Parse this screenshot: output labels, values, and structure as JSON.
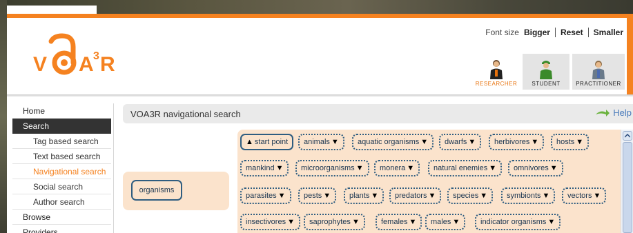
{
  "header": {
    "logo_text": "VOA3R",
    "font_size": {
      "label": "Font size",
      "bigger": "Bigger",
      "reset": "Reset",
      "smaller": "Smaller"
    },
    "roles": [
      {
        "label": "RESEARCHER",
        "icon": "researcher-icon"
      },
      {
        "label": "STUDENT",
        "icon": "student-icon"
      },
      {
        "label": "PRACTITIONER",
        "icon": "practitioner-icon"
      }
    ],
    "colors": {
      "accent": "#f58220",
      "node_border": "#2f5d80",
      "panel_bg": "#fbe3cc"
    }
  },
  "sidebar": {
    "items": [
      {
        "label": "Home"
      },
      {
        "label": "Search"
      },
      {
        "label": "Tag based search"
      },
      {
        "label": "Text based search"
      },
      {
        "label": "Navigational search"
      },
      {
        "label": "Social search"
      },
      {
        "label": "Author search"
      },
      {
        "label": "Browse"
      },
      {
        "label": "Providers"
      }
    ]
  },
  "main": {
    "title": "VOA3R navigational search",
    "help_label": "Help",
    "root_term": "organisms",
    "start_point": "start point",
    "terms": [
      "animals",
      "aquatic organisms",
      "dwarfs",
      "herbivores",
      "hosts",
      "mankind",
      "microorganisms",
      "monera",
      "natural enemies",
      "omnivores",
      "parasites",
      "pests",
      "plants",
      "predators",
      "species",
      "symbionts",
      "vectors",
      "insectivores",
      "saprophytes",
      "females",
      "males",
      "indicator organisms"
    ]
  }
}
